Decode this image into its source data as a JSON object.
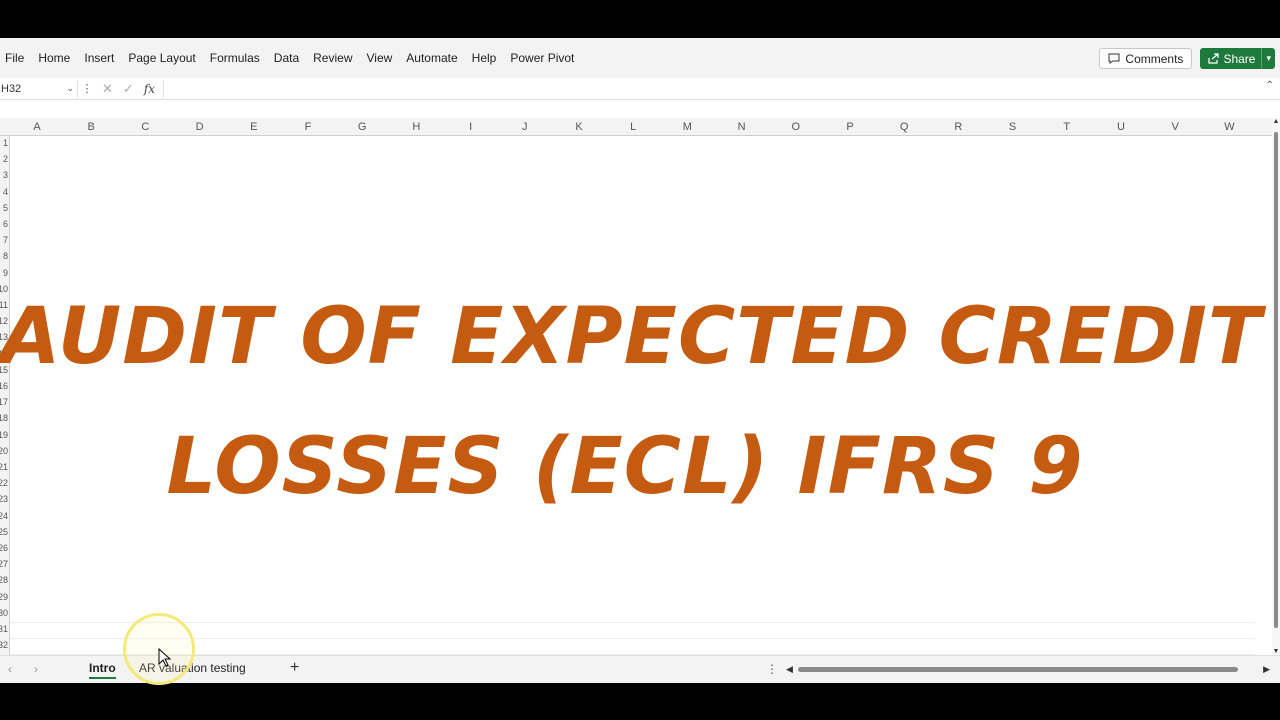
{
  "ribbon": {
    "tabs": [
      "File",
      "Home",
      "Insert",
      "Page Layout",
      "Formulas",
      "Data",
      "Review",
      "View",
      "Automate",
      "Help",
      "Power Pivot"
    ],
    "comments_label": "Comments",
    "share_label": "Share"
  },
  "formula_bar": {
    "name_box": "H32",
    "formula": ""
  },
  "columns": [
    "A",
    "B",
    "C",
    "D",
    "E",
    "F",
    "G",
    "H",
    "I",
    "J",
    "K",
    "L",
    "M",
    "N",
    "O",
    "P",
    "Q",
    "R",
    "S",
    "T",
    "U",
    "V",
    "W"
  ],
  "rows": [
    "1",
    "2",
    "3",
    "4",
    "5",
    "6",
    "7",
    "8",
    "9",
    "10",
    "11",
    "12",
    "13",
    "14",
    "15",
    "16",
    "17",
    "18",
    "19",
    "20",
    "21",
    "22",
    "23",
    "24",
    "25",
    "26",
    "27",
    "28",
    "29",
    "30",
    "31",
    "32"
  ],
  "content": {
    "title_line1": "AUDIT OF EXPECTED CREDIT",
    "title_line2": "LOSSES (ECL) IFRS 9"
  },
  "sheets": {
    "tabs": [
      "Intro",
      "AR valuation testing"
    ],
    "active": "Intro"
  },
  "colors": {
    "title": "#c55a11",
    "share_button": "#1e7a3c"
  }
}
